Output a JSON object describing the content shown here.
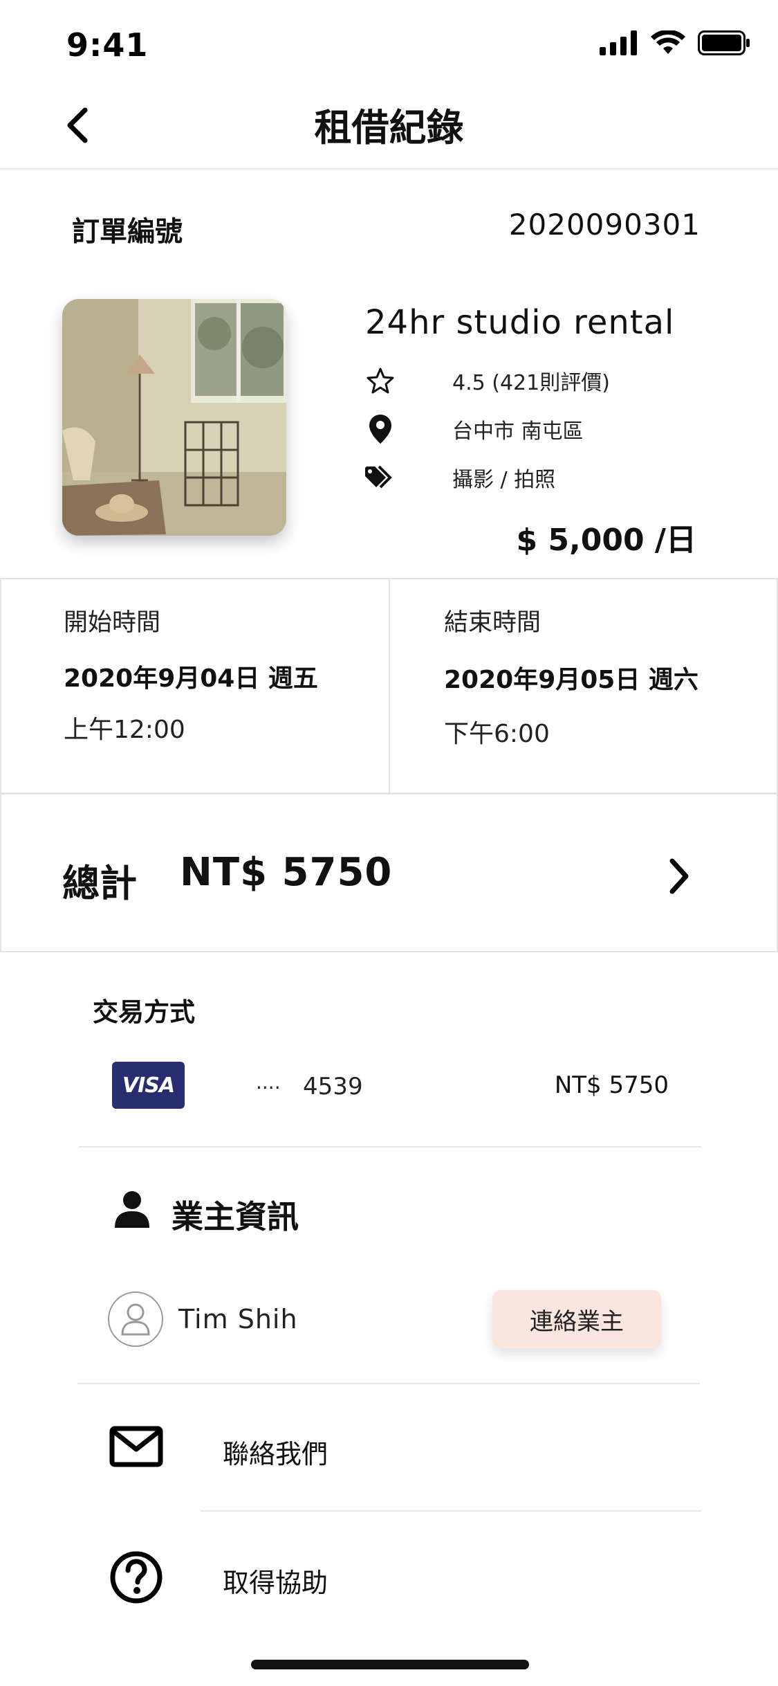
{
  "status_bar": {
    "time": "9:41",
    "signal_icon": "cellular-signal-icon",
    "wifi_icon": "wifi-icon",
    "battery_icon": "battery-icon"
  },
  "header": {
    "title": "租借紀錄",
    "back_icon": "chevron-left-icon"
  },
  "order": {
    "label": "訂單編號",
    "number": "2020090301"
  },
  "listing": {
    "title": "24hr studio rental",
    "rating_text": "4.5 (421則評價)",
    "location": "台中市 南屯區",
    "category": "攝影 / 拍照",
    "price": "$ 5,000 /日",
    "icons": [
      "star-icon",
      "location-pin-icon",
      "tags-icon"
    ]
  },
  "rental_time": {
    "start": {
      "label": "開始時間",
      "date": "2020年9月04日 週五",
      "time": "上午12:00"
    },
    "end": {
      "label": "結束時間",
      "date": "2020年9月05日 週六",
      "time": "下午6:00"
    }
  },
  "total": {
    "label": "總計",
    "value": "NT$ 5750",
    "chevron_icon": "chevron-right-icon"
  },
  "payment": {
    "title": "交易方式",
    "card_brand": "VISA",
    "card_mask": "····",
    "card_last4": "4539",
    "amount": "NT$ 5750",
    "brand_color": "#272d6e"
  },
  "owner": {
    "title": "業主資訊",
    "name": "Tim Shih",
    "contact_button": "連絡業主",
    "button_color": "#fbe5df"
  },
  "links": {
    "contact_us": "聯絡我們",
    "get_help": "取得協助"
  }
}
